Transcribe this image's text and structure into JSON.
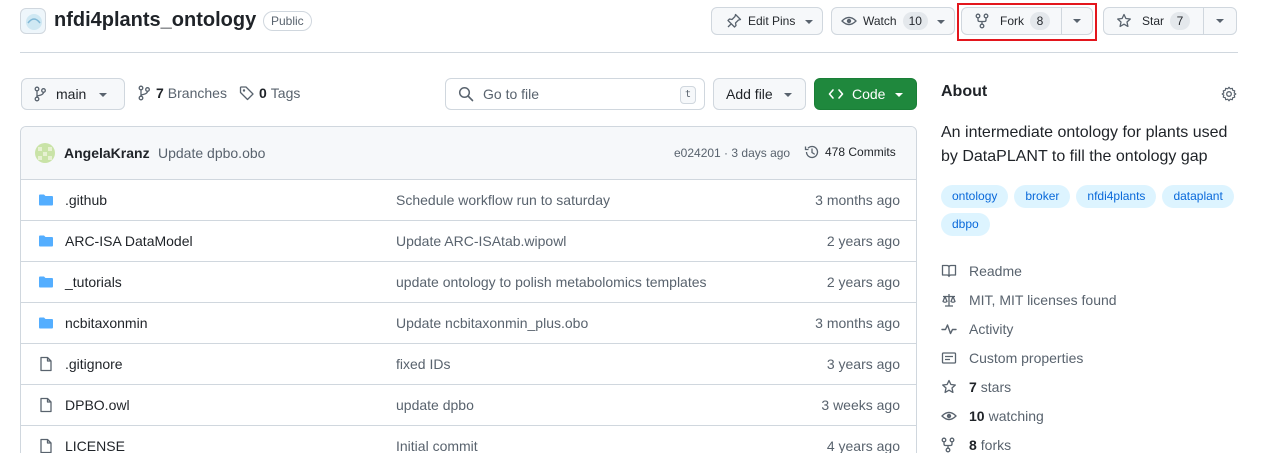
{
  "repo": {
    "name": "nfdi4plants_ontology",
    "visibility": "Public"
  },
  "actions": {
    "edit_pins": "Edit Pins",
    "watch_label": "Watch",
    "watch_count": "10",
    "fork_label": "Fork",
    "fork_count": "8",
    "star_label": "Star",
    "star_count": "7"
  },
  "toolbar": {
    "branch": "main",
    "branches_count": "7",
    "branches_label": "Branches",
    "tags_count": "0",
    "tags_label": "Tags",
    "goto_placeholder": "Go to file",
    "goto_shortcut": "t",
    "add_file": "Add file",
    "code": "Code"
  },
  "latest_commit": {
    "author": "AngelaKranz",
    "message": "Update dpbo.obo",
    "meta": "e024201 · 3 days ago",
    "commits_label": "478 Commits"
  },
  "files": [
    {
      "type": "folder",
      "name": ".github",
      "commit": "Schedule workflow run to saturday",
      "age": "3 months ago"
    },
    {
      "type": "folder",
      "name": "ARC-ISA DataModel",
      "commit": "Update ARC-ISAtab.wipowl",
      "age": "2 years ago"
    },
    {
      "type": "folder",
      "name": "_tutorials",
      "commit": "update ontology to polish metabolomics templates",
      "age": "2 years ago"
    },
    {
      "type": "folder",
      "name": "ncbitaxonmin",
      "commit": "Update ncbitaxonmin_plus.obo",
      "age": "3 months ago"
    },
    {
      "type": "file",
      "name": ".gitignore",
      "commit": "fixed IDs",
      "age": "3 years ago"
    },
    {
      "type": "file",
      "name": "DPBO.owl",
      "commit": "update dpbo",
      "age": "3 weeks ago"
    },
    {
      "type": "file",
      "name": "LICENSE",
      "commit": "Initial commit",
      "age": "4 years ago"
    }
  ],
  "about": {
    "title": "About",
    "description": "An intermediate ontology for plants used by DataPLANT to fill the ontology gap",
    "topics": [
      "ontology",
      "broker",
      "nfdi4plants",
      "dataplant",
      "dbpo"
    ],
    "readme": "Readme",
    "license": "MIT, MIT licenses found",
    "activity": "Activity",
    "custom_properties": "Custom properties",
    "stars_count": "7",
    "stars_label": "stars",
    "watching_count": "10",
    "watching_label": "watching",
    "forks_count": "8",
    "forks_label": "forks"
  },
  "colors": {
    "accent": "#0969da",
    "code_button": "#1f883d",
    "highlight": "#e3161d",
    "folder": "#54aeff"
  }
}
